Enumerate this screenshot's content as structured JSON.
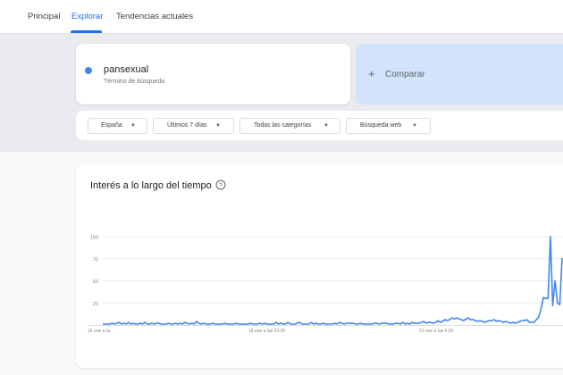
{
  "nav": {
    "tabs": [
      {
        "label": "Principal"
      },
      {
        "label": "Explorar"
      },
      {
        "label": "Tendencias actuales"
      }
    ],
    "active_tab": "Explorar"
  },
  "search": {
    "term": "pansexual",
    "term_subtitle": "Término de búsqueda",
    "term_color": "#4285f4",
    "compare_label": "Comparar"
  },
  "filters": {
    "region": "España",
    "period": "Últimos 7 días",
    "category": "Todas las categorías",
    "search_type": "Búsqueda web"
  },
  "chart": {
    "title": "Interés a lo largo del tiempo",
    "help_icon": "help-circle-icon"
  },
  "chart_data": {
    "type": "line",
    "title": "Interés a lo largo del tiempo",
    "xlabel": "",
    "ylabel": "",
    "ylim": [
      0,
      100
    ],
    "y_ticks": [
      100,
      75,
      50,
      25
    ],
    "x_tick_labels": [
      "16 ene a la...",
      "18 ene a las 23:00",
      "21 ene a las 6:00"
    ],
    "grid": true,
    "line_color": "#4285f4",
    "series": [
      {
        "values": [
          1,
          1,
          1,
          1,
          2,
          1,
          2,
          3,
          1,
          2,
          1,
          3,
          1,
          2,
          1,
          1,
          2,
          1,
          3,
          1,
          1,
          2,
          1,
          2,
          2,
          1,
          1,
          1,
          2,
          1,
          1,
          2,
          1,
          2,
          1,
          3,
          2,
          1,
          2,
          1,
          4,
          2,
          1,
          2,
          1,
          1,
          1,
          2,
          1,
          1,
          1,
          1,
          2,
          1,
          1,
          1,
          1,
          2,
          1,
          1,
          1,
          1,
          1,
          2,
          1,
          1,
          1,
          2,
          1,
          2,
          1,
          1,
          1,
          1,
          3,
          1,
          2,
          1,
          1,
          3,
          1,
          1,
          1,
          2,
          3,
          1,
          1,
          1,
          1,
          3,
          1,
          2,
          1,
          1,
          2,
          1,
          1,
          1,
          1,
          2,
          1,
          3,
          2,
          1,
          2,
          2,
          2,
          2,
          1,
          1,
          2,
          1,
          1,
          1,
          1,
          1,
          2,
          2,
          1,
          2,
          2,
          2,
          1,
          1,
          1,
          2,
          2,
          1,
          3,
          1,
          2,
          1,
          3,
          2,
          2,
          2,
          3,
          4,
          2,
          3,
          3,
          2,
          3,
          5,
          3,
          4,
          6,
          5,
          6,
          8,
          7,
          8,
          7,
          6,
          5,
          7,
          8,
          6,
          6,
          5,
          4,
          5,
          4,
          3,
          4,
          5,
          5,
          6,
          4,
          5,
          4,
          3,
          4,
          3,
          2,
          3,
          2,
          3,
          4,
          5,
          5,
          6,
          3,
          3,
          3,
          6,
          9,
          18,
          31,
          30,
          30,
          100,
          22,
          50,
          25,
          23,
          76
        ]
      }
    ]
  }
}
